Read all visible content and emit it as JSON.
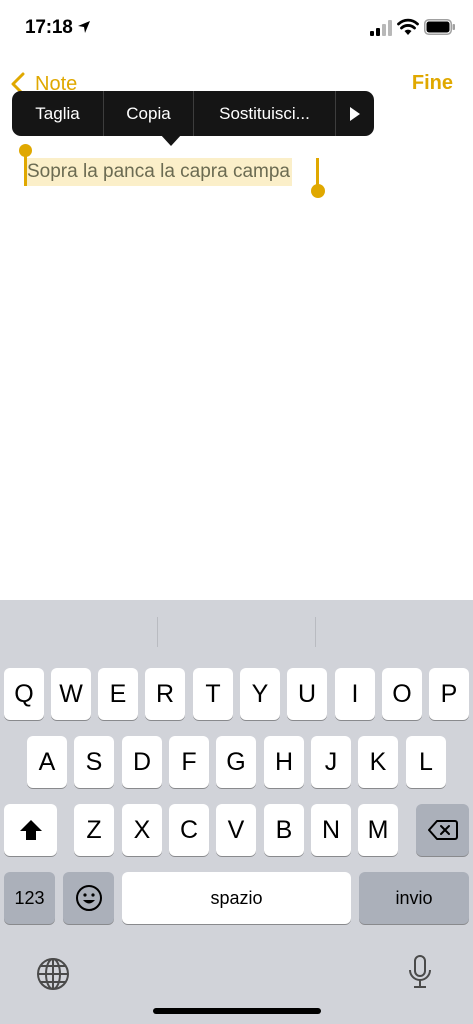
{
  "status": {
    "time": "17:18"
  },
  "nav": {
    "back_label": "Note",
    "done_label": "Fine"
  },
  "menu": {
    "cut": "Taglia",
    "copy": "Copia",
    "replace": "Sostituisci..."
  },
  "note": {
    "text": "Sopra la panca la capra campa"
  },
  "keyboard": {
    "row1": [
      "Q",
      "W",
      "E",
      "R",
      "T",
      "Y",
      "U",
      "I",
      "O",
      "P"
    ],
    "row2": [
      "A",
      "S",
      "D",
      "F",
      "G",
      "H",
      "J",
      "K",
      "L"
    ],
    "row3": [
      "Z",
      "X",
      "C",
      "V",
      "B",
      "N",
      "M"
    ],
    "numbers_label": "123",
    "space_label": "spazio",
    "return_label": "invio"
  },
  "colors": {
    "accent": "#e0a800",
    "selection": "#fbefc9",
    "menu_bg": "#151515",
    "keyboard_bg": "#d1d3d9"
  },
  "icons": [
    "location-arrow-icon",
    "cellular-signal-icon",
    "wifi-icon",
    "battery-icon",
    "chevron-left-icon",
    "play-icon",
    "shift-icon",
    "backspace-icon",
    "emoji-icon",
    "globe-icon",
    "microphone-icon"
  ]
}
